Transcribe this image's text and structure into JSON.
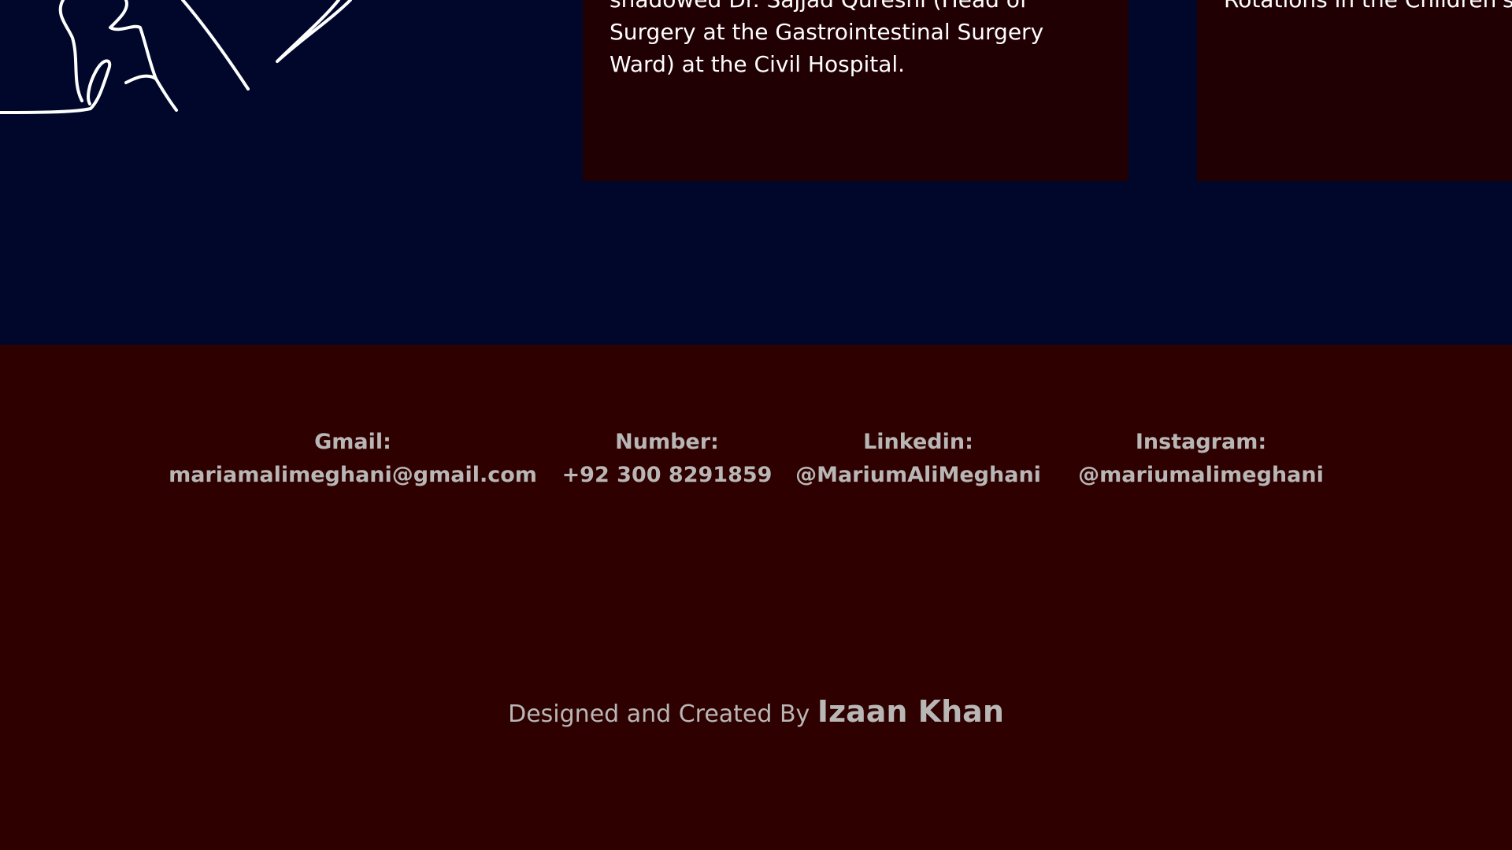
{
  "experience": {
    "cards": [
      {
        "text": "shadowed Dr. Sajjad Qureshi (Head of Surgery at the Gastrointestinal Surgery Ward) at the Civil Hospital."
      },
      {
        "text": "Rotations in the Children's"
      }
    ]
  },
  "footer": {
    "contacts": [
      {
        "label": "Gmail:",
        "value": "mariamalimeghani@gmail.com"
      },
      {
        "label": "Number:",
        "value": "+92 300 8291859"
      },
      {
        "label": "Linkedin:",
        "value": "@MariumAliMeghani"
      },
      {
        "label": "Instagram:",
        "value": "@mariumalimeghani"
      }
    ],
    "credit": {
      "prefix": "Designed and Created By",
      "author": "Izaan Khan"
    }
  },
  "colors": {
    "navy_background": "#00072b",
    "card_background": "#210003",
    "footer_background": "#2e0000",
    "footer_text": "#b9b6b6"
  },
  "icons": {
    "sketch": "line-art-illustration"
  }
}
